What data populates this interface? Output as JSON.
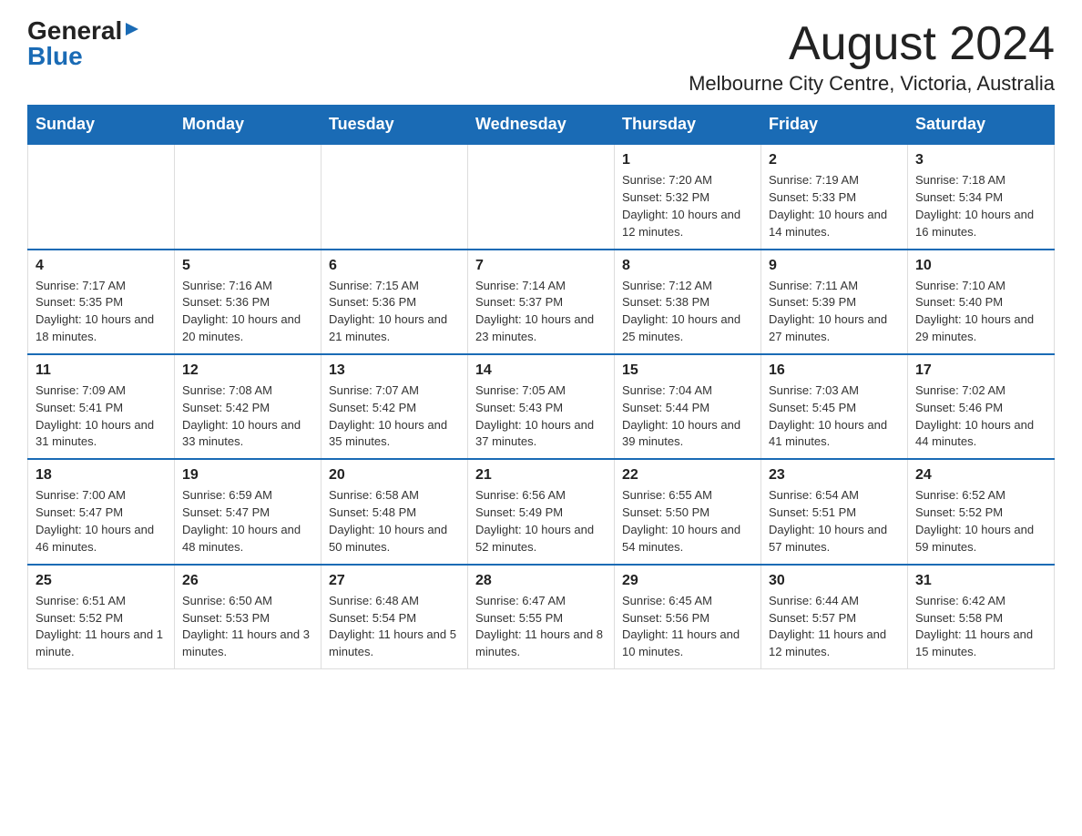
{
  "logo": {
    "general": "General",
    "triangle": "▶",
    "blue": "Blue"
  },
  "title": "August 2024",
  "subtitle": "Melbourne City Centre, Victoria, Australia",
  "days_of_week": [
    "Sunday",
    "Monday",
    "Tuesday",
    "Wednesday",
    "Thursday",
    "Friday",
    "Saturday"
  ],
  "weeks": [
    [
      {
        "num": "",
        "info": ""
      },
      {
        "num": "",
        "info": ""
      },
      {
        "num": "",
        "info": ""
      },
      {
        "num": "",
        "info": ""
      },
      {
        "num": "1",
        "info": "Sunrise: 7:20 AM\nSunset: 5:32 PM\nDaylight: 10 hours\nand 12 minutes."
      },
      {
        "num": "2",
        "info": "Sunrise: 7:19 AM\nSunset: 5:33 PM\nDaylight: 10 hours\nand 14 minutes."
      },
      {
        "num": "3",
        "info": "Sunrise: 7:18 AM\nSunset: 5:34 PM\nDaylight: 10 hours\nand 16 minutes."
      }
    ],
    [
      {
        "num": "4",
        "info": "Sunrise: 7:17 AM\nSunset: 5:35 PM\nDaylight: 10 hours\nand 18 minutes."
      },
      {
        "num": "5",
        "info": "Sunrise: 7:16 AM\nSunset: 5:36 PM\nDaylight: 10 hours\nand 20 minutes."
      },
      {
        "num": "6",
        "info": "Sunrise: 7:15 AM\nSunset: 5:36 PM\nDaylight: 10 hours\nand 21 minutes."
      },
      {
        "num": "7",
        "info": "Sunrise: 7:14 AM\nSunset: 5:37 PM\nDaylight: 10 hours\nand 23 minutes."
      },
      {
        "num": "8",
        "info": "Sunrise: 7:12 AM\nSunset: 5:38 PM\nDaylight: 10 hours\nand 25 minutes."
      },
      {
        "num": "9",
        "info": "Sunrise: 7:11 AM\nSunset: 5:39 PM\nDaylight: 10 hours\nand 27 minutes."
      },
      {
        "num": "10",
        "info": "Sunrise: 7:10 AM\nSunset: 5:40 PM\nDaylight: 10 hours\nand 29 minutes."
      }
    ],
    [
      {
        "num": "11",
        "info": "Sunrise: 7:09 AM\nSunset: 5:41 PM\nDaylight: 10 hours\nand 31 minutes."
      },
      {
        "num": "12",
        "info": "Sunrise: 7:08 AM\nSunset: 5:42 PM\nDaylight: 10 hours\nand 33 minutes."
      },
      {
        "num": "13",
        "info": "Sunrise: 7:07 AM\nSunset: 5:42 PM\nDaylight: 10 hours\nand 35 minutes."
      },
      {
        "num": "14",
        "info": "Sunrise: 7:05 AM\nSunset: 5:43 PM\nDaylight: 10 hours\nand 37 minutes."
      },
      {
        "num": "15",
        "info": "Sunrise: 7:04 AM\nSunset: 5:44 PM\nDaylight: 10 hours\nand 39 minutes."
      },
      {
        "num": "16",
        "info": "Sunrise: 7:03 AM\nSunset: 5:45 PM\nDaylight: 10 hours\nand 41 minutes."
      },
      {
        "num": "17",
        "info": "Sunrise: 7:02 AM\nSunset: 5:46 PM\nDaylight: 10 hours\nand 44 minutes."
      }
    ],
    [
      {
        "num": "18",
        "info": "Sunrise: 7:00 AM\nSunset: 5:47 PM\nDaylight: 10 hours\nand 46 minutes."
      },
      {
        "num": "19",
        "info": "Sunrise: 6:59 AM\nSunset: 5:47 PM\nDaylight: 10 hours\nand 48 minutes."
      },
      {
        "num": "20",
        "info": "Sunrise: 6:58 AM\nSunset: 5:48 PM\nDaylight: 10 hours\nand 50 minutes."
      },
      {
        "num": "21",
        "info": "Sunrise: 6:56 AM\nSunset: 5:49 PM\nDaylight: 10 hours\nand 52 minutes."
      },
      {
        "num": "22",
        "info": "Sunrise: 6:55 AM\nSunset: 5:50 PM\nDaylight: 10 hours\nand 54 minutes."
      },
      {
        "num": "23",
        "info": "Sunrise: 6:54 AM\nSunset: 5:51 PM\nDaylight: 10 hours\nand 57 minutes."
      },
      {
        "num": "24",
        "info": "Sunrise: 6:52 AM\nSunset: 5:52 PM\nDaylight: 10 hours\nand 59 minutes."
      }
    ],
    [
      {
        "num": "25",
        "info": "Sunrise: 6:51 AM\nSunset: 5:52 PM\nDaylight: 11 hours\nand 1 minute."
      },
      {
        "num": "26",
        "info": "Sunrise: 6:50 AM\nSunset: 5:53 PM\nDaylight: 11 hours\nand 3 minutes."
      },
      {
        "num": "27",
        "info": "Sunrise: 6:48 AM\nSunset: 5:54 PM\nDaylight: 11 hours\nand 5 minutes."
      },
      {
        "num": "28",
        "info": "Sunrise: 6:47 AM\nSunset: 5:55 PM\nDaylight: 11 hours\nand 8 minutes."
      },
      {
        "num": "29",
        "info": "Sunrise: 6:45 AM\nSunset: 5:56 PM\nDaylight: 11 hours\nand 10 minutes."
      },
      {
        "num": "30",
        "info": "Sunrise: 6:44 AM\nSunset: 5:57 PM\nDaylight: 11 hours\nand 12 minutes."
      },
      {
        "num": "31",
        "info": "Sunrise: 6:42 AM\nSunset: 5:58 PM\nDaylight: 11 hours\nand 15 minutes."
      }
    ]
  ]
}
